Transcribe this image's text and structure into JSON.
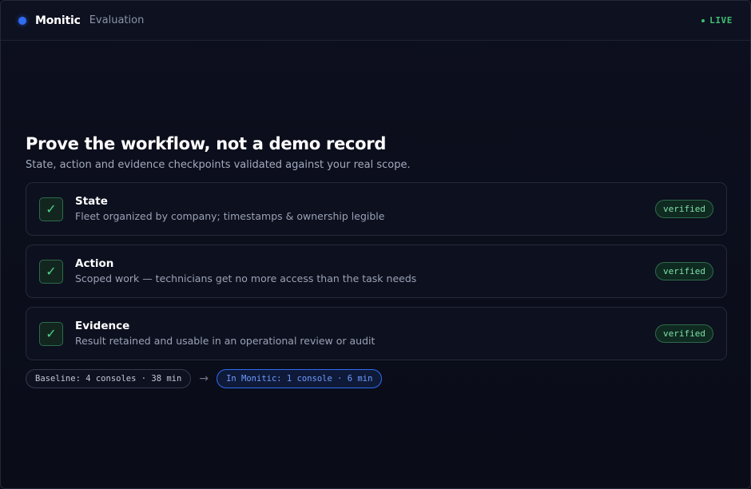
{
  "header": {
    "brand": "Monitic",
    "section": "Evaluation",
    "status": "LIVE"
  },
  "main": {
    "title": "Prove the workflow, not a demo record",
    "subtitle": "State, action and evidence checkpoints validated against your real scope.",
    "checkpoints": [
      {
        "title": "State",
        "description": "Fleet organized by company; timestamps & ownership legible",
        "status": "verified",
        "icon": "check-icon"
      },
      {
        "title": "Action",
        "description": "Scoped work — technicians get no more access than the task needs",
        "status": "verified",
        "icon": "check-icon"
      },
      {
        "title": "Evidence",
        "description": "Result retained and usable in an operational review or audit",
        "status": "verified",
        "icon": "check-icon"
      }
    ],
    "comparison": {
      "baseline": "Baseline: 4 consoles · 38 min",
      "arrow": "→",
      "result": "In Monitic: 1 console · 6 min"
    }
  },
  "colors": {
    "accent": "#2f6cf4",
    "success": "#3fbf72",
    "background": "#0a0c16"
  }
}
